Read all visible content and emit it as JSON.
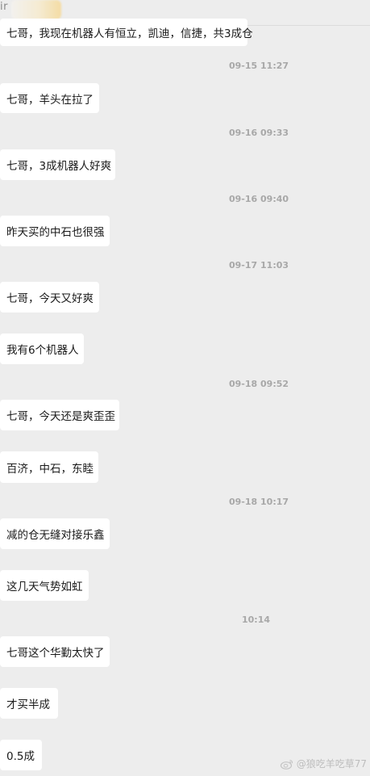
{
  "header": {
    "truncated_title": "ir"
  },
  "messages": [
    {
      "text": "七哥，我现在机器人有恒立，凯迪，信捷，共3成仓"
    },
    {
      "timestamp": "09-15 11:27"
    },
    {
      "text": "七哥，羊头在拉了"
    },
    {
      "timestamp": "09-16 09:33"
    },
    {
      "text": "七哥，3成机器人好爽"
    },
    {
      "timestamp": "09-16 09:40"
    },
    {
      "text": "昨天买的中石也很强"
    },
    {
      "timestamp": "09-17 11:03"
    },
    {
      "text": "七哥，今天又好爽"
    },
    {
      "text": "我有6个机器人"
    },
    {
      "timestamp": "09-18 09:52"
    },
    {
      "text": "七哥，今天还是爽歪歪"
    },
    {
      "text": "百济，中石，东睦"
    },
    {
      "timestamp": "09-18 10:17"
    },
    {
      "text": "减的仓无缝对接乐鑫"
    },
    {
      "text": "这几天气势如虹"
    },
    {
      "timestamp": "10:14"
    },
    {
      "text": "七哥这个华勤太快了"
    },
    {
      "text": "才买半成"
    },
    {
      "text": "0.5成"
    }
  ],
  "watermark": {
    "text": "@狼吃羊吃草77",
    "icon": "weibo-icon"
  },
  "colors": {
    "background": "#ededed",
    "bubble": "#ffffff",
    "timestamp": "#a8a8a8"
  }
}
